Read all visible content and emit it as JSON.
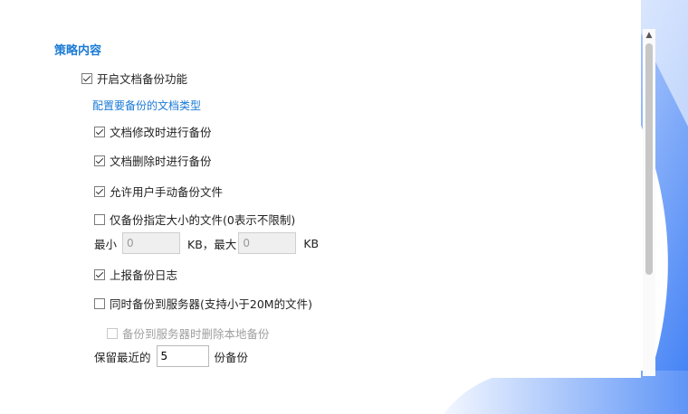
{
  "section": {
    "title": "策略内容"
  },
  "options": {
    "enable_backup": {
      "label": "开启文档备份功能",
      "checked": true
    },
    "doc_types_label": "配置要备份的文档类型",
    "backup_on_modify": {
      "label": "文档修改时进行备份",
      "checked": true
    },
    "backup_on_delete": {
      "label": "文档删除时进行备份",
      "checked": true
    },
    "allow_manual": {
      "label": "允许用户手动备份文件",
      "checked": true
    },
    "size_limit": {
      "label": "仅备份指定大小的文件(0表示不限制)",
      "checked": false
    },
    "size_range": {
      "min_label": "最小",
      "min_value": "0",
      "min_unit": "KB，",
      "max_label": "最大",
      "max_value": "0",
      "max_unit": "KB"
    },
    "report_log": {
      "label": "上报备份日志",
      "checked": true
    },
    "sync_server": {
      "label": "同时备份到服务器(支持小于20M的文件)",
      "checked": false
    },
    "delete_local": {
      "label": "备份到服务器时删除本地备份",
      "checked": false,
      "disabled": true
    },
    "retain": {
      "prefix": "保留最近的",
      "value": "5",
      "suffix": "份备份"
    }
  },
  "colors": {
    "accent": "#1a7ad6",
    "decor_blue": "#3d7ef5"
  },
  "icons": {
    "scroll_up": "chevron-up-icon"
  }
}
